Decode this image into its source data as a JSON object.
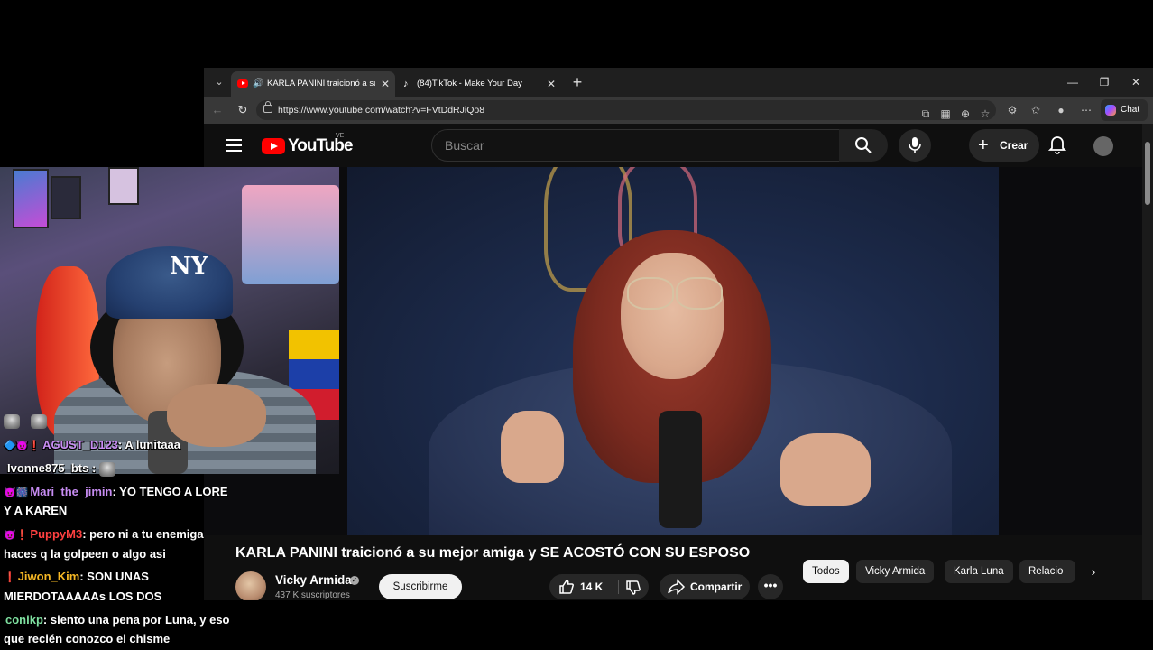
{
  "browser": {
    "tabs": [
      {
        "title": "KARLA PANINI traicionó a su r",
        "active": true,
        "favicon": "youtube-icon"
      },
      {
        "title": "(84)TikTok - Make Your Day",
        "active": false,
        "favicon": "tiktok-icon"
      }
    ],
    "url": "https://www.youtube.com/watch?v=FVtDdRJiQo8",
    "chat_label": "Chat"
  },
  "youtube": {
    "logo_text": "YouTube",
    "country_code": "VE",
    "search_placeholder": "Buscar",
    "create_label": "Crear",
    "video_title": "KARLA PANINI traicionó a su mejor amiga y SE ACOSTÓ CON SU ESPOSO",
    "channel_name": "Vicky Armida",
    "subscribers": "437 K suscriptores",
    "subscribe_label": "Suscribirme",
    "likes": "14 K",
    "share_label": "Compartir",
    "more_label": "•••",
    "chips": [
      "Todos",
      "Vicky Armida",
      "Karla Luna",
      "Relacio"
    ]
  },
  "chat": {
    "messages": [
      {
        "user": "AGUST_D123",
        "user_color": "#c78cf2",
        "text": ": A lunitaaa",
        "badges": "🔷😈❗"
      },
      {
        "user": "Ivonne875_bts",
        "user_color": "#ffffff",
        "text": " :",
        "badges": ""
      },
      {
        "user": "Mari_the_jimin",
        "user_color": "#c78cf2",
        "text": ": YO TENGO A LORE",
        "text2": "Y A KAREN",
        "badges": "😈🎆"
      },
      {
        "user": "PuppyM3",
        "user_color": "#ff4040",
        "text": ": pero ni a tu enemiga",
        "text2": "haces q la golpeen o algo asi",
        "badges": "😈❗"
      },
      {
        "user": "Jiwon_Kim",
        "user_color": "#f5b724",
        "text": ": SON UNAS",
        "text2": "MIERDOTAAAAAs LOS DOS",
        "badges": "❗"
      },
      {
        "user": "conikp",
        "user_color": "#7fe0a0",
        "text": ": siento una pena por Luna, y eso",
        "text2": "que recién conozco el chisme",
        "badges": ""
      }
    ]
  },
  "colors": {
    "yt_red": "#ff0000",
    "yt_bg": "#0f0f0f"
  }
}
